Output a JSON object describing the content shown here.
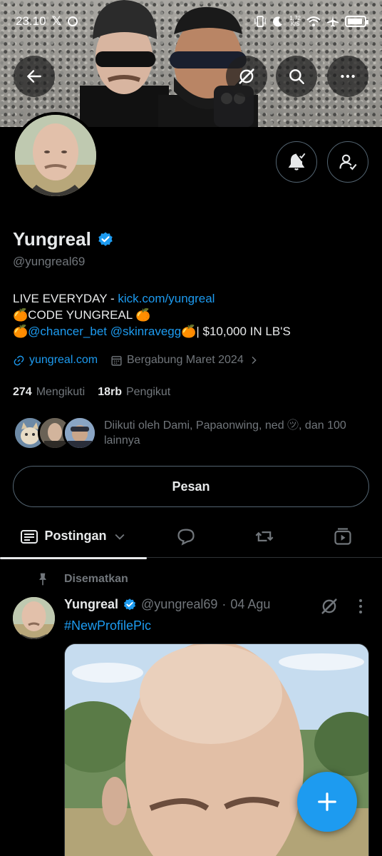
{
  "status_bar": {
    "time": "23.10",
    "net_speed_value": "1,72",
    "net_speed_unit": "K/S"
  },
  "profile": {
    "name": "Yungreal",
    "handle": "@yungreal69",
    "bio_line1_prefix": "LIVE EVERYDAY - ",
    "bio_line1_link": "kick.com/yungreal",
    "bio_line2": "🍊CODE YUNGREAL 🍊",
    "bio_line3_emoji": "🍊",
    "bio_line3_mention1": "@chancer_bet",
    "bio_line3_mention2": "@skinravegg",
    "bio_line3_suffix": "🍊| $10,000 IN LB'S",
    "website": "yungreal.com",
    "joined": "Bergabung Maret 2024",
    "following_count": "274",
    "following_label": "Mengikuti",
    "followers_count": "18rb",
    "followers_label": "Pengikut",
    "followed_by": "Diikuti oleh Dami, Papaonwing, ned ㋡, dan 100 lainnya",
    "message_button": "Pesan"
  },
  "tabs": {
    "active_label": "Postingan"
  },
  "pinned_post": {
    "pinned_label": "Disematkan",
    "author_name": "Yungreal",
    "author_handle": "@yungreal69",
    "separator": "·",
    "date": "04 Agu",
    "text": "#NewProfilePic"
  },
  "colors": {
    "accent": "#1d9bf0",
    "secondary_text": "#71767b",
    "border": "#2f3336",
    "background": "#000000"
  },
  "icons": [
    "back-arrow-icon",
    "grok-icon",
    "search-icon",
    "more-icon",
    "bell-check-icon",
    "following-check-icon",
    "verified-badge-icon",
    "link-icon",
    "calendar-icon",
    "chevron-right-icon",
    "posts-icon",
    "reply-icon",
    "repost-icon",
    "video-icon",
    "pin-icon",
    "kebab-icon",
    "plus-icon"
  ]
}
